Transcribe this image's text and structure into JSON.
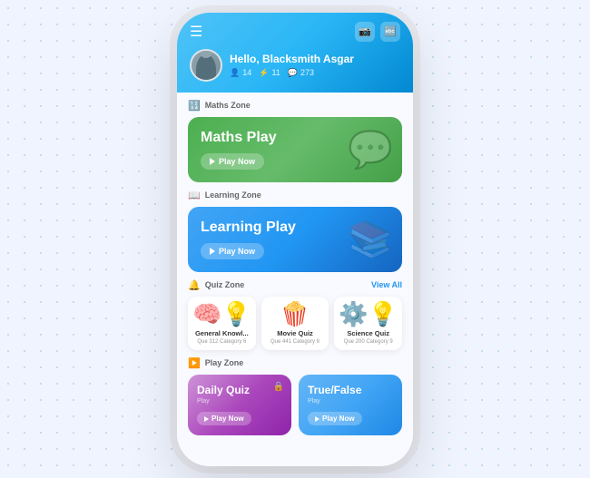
{
  "header": {
    "greeting": "Hello, Blacksmith Asgar",
    "stats": [
      {
        "icon": "👤",
        "value": "14"
      },
      {
        "icon": "⚡",
        "value": "11"
      },
      {
        "icon": "💬",
        "value": "273"
      }
    ],
    "icons": [
      "📷",
      "🔤"
    ]
  },
  "sections": {
    "maths_zone": {
      "label": "Maths Zone",
      "card_title": "Maths Play",
      "play_label": "Play Now"
    },
    "learning_zone": {
      "label": "Learning Zone",
      "card_title": "Learning Play",
      "play_label": "Play Now"
    },
    "quiz_zone": {
      "label": "Quiz Zone",
      "view_all": "View All",
      "cards": [
        {
          "emoji": "💡🧠",
          "title": "General Knowl...",
          "sub": "Que 312  Category 6"
        },
        {
          "emoji": "🍿",
          "title": "Movie Quiz",
          "sub": "Que 441  Category 8"
        },
        {
          "emoji": "💡⚙️",
          "title": "Science Quiz",
          "sub": "Que 200  Category 9"
        }
      ]
    },
    "play_zone": {
      "label": "Play Zone",
      "daily_quiz": {
        "title": "Daily Quiz",
        "sub": "Play",
        "play_label": "Play Now"
      },
      "true_false": {
        "title": "True/False",
        "sub": "Play",
        "play_label": "Play Now"
      }
    }
  }
}
